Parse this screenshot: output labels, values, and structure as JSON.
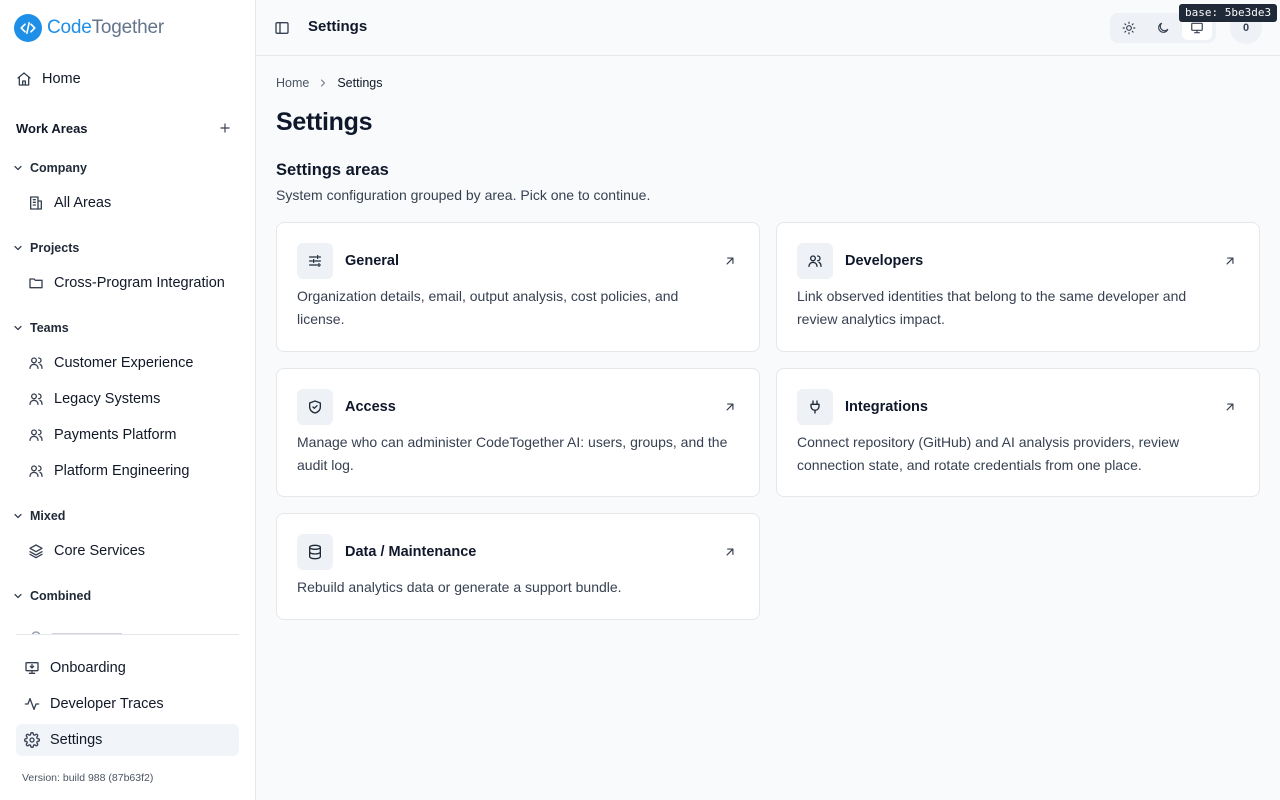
{
  "brand": {
    "name_part1": "Code",
    "name_part2": "Together"
  },
  "sidebar": {
    "home_label": "Home",
    "work_areas_label": "Work Areas",
    "groups": [
      {
        "label": "Company",
        "items": [
          {
            "label": "All Areas",
            "icon": "building-icon"
          }
        ]
      },
      {
        "label": "Projects",
        "items": [
          {
            "label": "Cross-Program Integration",
            "icon": "folder-icon"
          }
        ]
      },
      {
        "label": "Teams",
        "items": [
          {
            "label": "Customer Experience",
            "icon": "users-icon"
          },
          {
            "label": "Legacy Systems",
            "icon": "users-icon"
          },
          {
            "label": "Payments Platform",
            "icon": "users-icon"
          },
          {
            "label": "Platform Engineering",
            "icon": "users-icon"
          }
        ]
      },
      {
        "label": "Mixed",
        "items": [
          {
            "label": "Core Services",
            "icon": "layers-icon"
          }
        ]
      },
      {
        "label": "Combined",
        "items": []
      }
    ],
    "bottom": [
      {
        "label": "Onboarding",
        "icon": "monitor-download-icon"
      },
      {
        "label": "Developer Traces",
        "icon": "activity-icon"
      },
      {
        "label": "Settings",
        "icon": "gear-icon",
        "active": true
      }
    ],
    "version": "Version: build 988 (87b63f2)"
  },
  "header": {
    "title": "Settings",
    "theme_options": [
      "sun-icon",
      "moon-icon",
      "monitor-icon"
    ],
    "theme_selected": "monitor-icon",
    "avatar_text": "0",
    "base_tag": "base: 5be3de3"
  },
  "breadcrumb": {
    "home": "Home",
    "current": "Settings"
  },
  "page": {
    "title": "Settings",
    "section_title": "Settings areas",
    "section_desc": "System configuration grouped by area. Pick one to continue."
  },
  "cards": [
    {
      "title": "General",
      "icon": "sliders-icon",
      "desc": "Organization details, email, output analysis, cost policies, and license."
    },
    {
      "title": "Developers",
      "icon": "users-icon",
      "desc": "Link observed identities that belong to the same developer and review analytics impact."
    },
    {
      "title": "Access",
      "icon": "shield-icon",
      "desc": "Manage who can administer CodeTogether AI: users, groups, and the audit log."
    },
    {
      "title": "Integrations",
      "icon": "plug-icon",
      "desc": "Connect repository (GitHub) and AI analysis providers, review connection state, and rotate credentials from one place."
    },
    {
      "title": "Data / Maintenance",
      "icon": "database-icon",
      "desc": "Rebuild analytics data or generate a support bundle."
    }
  ],
  "colors": {
    "brand": "#1d8fe6",
    "background": "#f8fafc",
    "card": "#ffffff",
    "border": "#e5e7eb"
  }
}
